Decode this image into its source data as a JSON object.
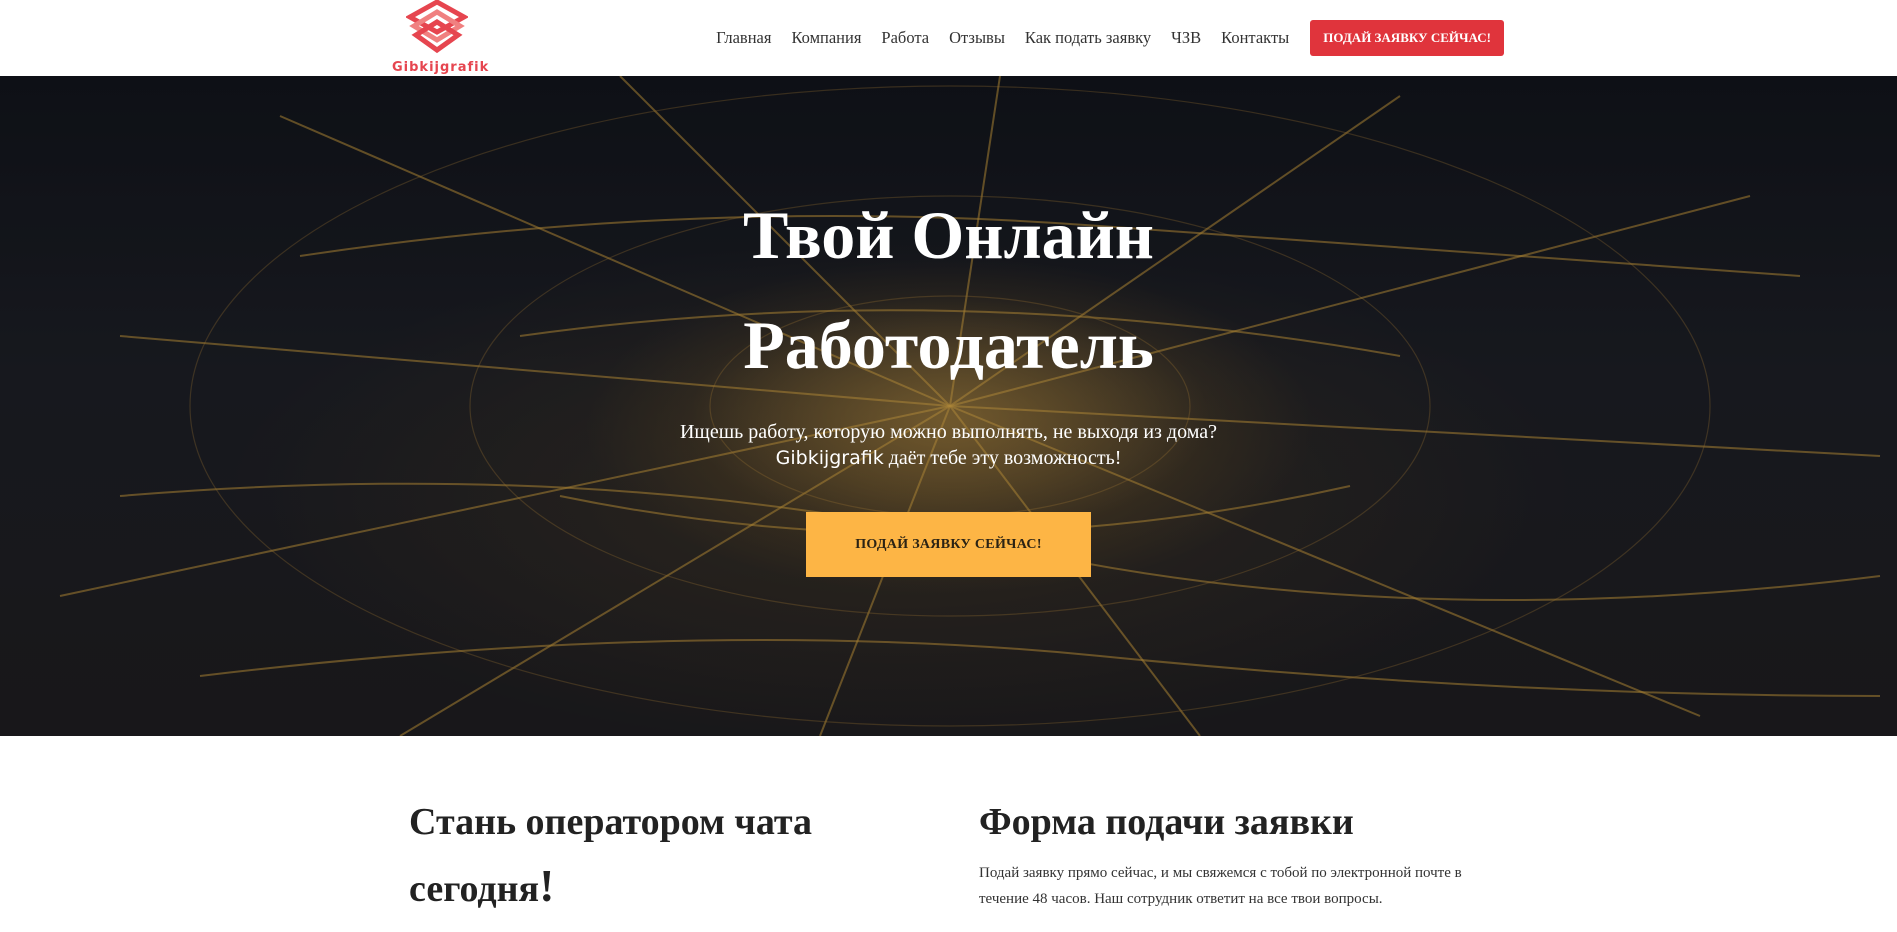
{
  "header": {
    "logo_text": "Gibkijgrafik",
    "nav": [
      {
        "label": "Главная"
      },
      {
        "label": "Компания"
      },
      {
        "label": "Работа"
      },
      {
        "label": "Отзывы"
      },
      {
        "label": "Как подать заявку"
      },
      {
        "label": "ЧЗВ"
      },
      {
        "label": "Контакты"
      }
    ],
    "cta_label": "ПОДАЙ ЗАЯВКУ СЕЙЧАС!",
    "accent_color": "#e0343c",
    "logo_icon": "stacked-diamond-logo-icon"
  },
  "hero": {
    "title_line1": "Твой Онлайн",
    "title_line2": "Работодатель",
    "subtitle_line1": "Ищешь работу, которую можно выполнять, не выходя из дома?",
    "subtitle_brand": "Gibkijgrafik",
    "subtitle_line2_rest": " даёт тебе эту возможность!",
    "button_label": "ПОДАЙ ЗАЯВКУ СЕЙЧАС!",
    "button_color": "#fdb545"
  },
  "left": {
    "heading_text": "Стань оператором чата сегодня",
    "heading_mark": "!"
  },
  "right": {
    "heading": "Форма подачи заявки",
    "paragraph": "Подай заявку прямо сейчас, и мы свяжемся с тобой по электронной почте в течение 48 часов. Наш сотрудник ответит на все твои вопросы."
  }
}
